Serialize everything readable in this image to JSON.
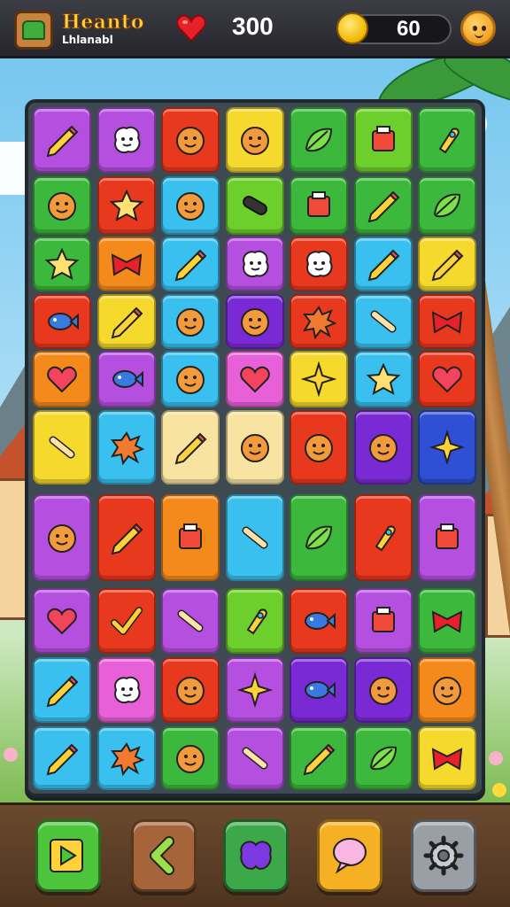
{
  "header": {
    "title": "Heanto",
    "subtitle": "Lhlanabl",
    "score": "300",
    "coins": "60"
  },
  "colors": {
    "purple": "#b54fe0",
    "red": "#e8381e",
    "yellow": "#f5d92c",
    "green": "#3cb83c",
    "blue": "#39c0ef",
    "orange": "#f58a1c",
    "dpurple": "#7a2ad4",
    "pink": "#e860d8",
    "cream": "#f8e4a0",
    "royal": "#2f4fd4",
    "lime": "#6ccf2c"
  },
  "board": {
    "rows": [
      [
        {
          "c": "purple",
          "i": "pencil"
        },
        {
          "c": "purple",
          "i": "blob-face"
        },
        {
          "c": "red",
          "i": "face"
        },
        {
          "c": "yellow",
          "i": "face"
        },
        {
          "c": "green",
          "i": "leaf"
        },
        {
          "c": "lime",
          "i": "box"
        },
        {
          "c": "green",
          "i": "rocket"
        }
      ],
      [
        {
          "c": "green",
          "i": "face"
        },
        {
          "c": "red",
          "i": "star"
        },
        {
          "c": "blue",
          "i": "face"
        },
        {
          "c": "lime",
          "i": "bar"
        },
        {
          "c": "green",
          "i": "box"
        },
        {
          "c": "green",
          "i": "pencil"
        },
        {
          "c": "green",
          "i": "leaf"
        }
      ],
      [
        {
          "c": "green",
          "i": "star"
        },
        {
          "c": "orange",
          "i": "bow"
        },
        {
          "c": "blue",
          "i": "pencil"
        },
        {
          "c": "purple",
          "i": "blob-face"
        },
        {
          "c": "red",
          "i": "blob-face"
        },
        {
          "c": "blue",
          "i": "pencil"
        },
        {
          "c": "yellow",
          "i": "pencil"
        }
      ],
      [
        {
          "c": "red",
          "i": "fish"
        },
        {
          "c": "yellow",
          "i": "pencil"
        },
        {
          "c": "blue",
          "i": "face"
        },
        {
          "c": "dpurple",
          "i": "face"
        },
        {
          "c": "red",
          "i": "splat"
        },
        {
          "c": "blue",
          "i": "bone"
        },
        {
          "c": "red",
          "i": "bow"
        }
      ],
      [
        {
          "c": "orange",
          "i": "heart"
        },
        {
          "c": "purple",
          "i": "fish"
        },
        {
          "c": "blue",
          "i": "face"
        },
        {
          "c": "pink",
          "i": "heart"
        },
        {
          "c": "yellow",
          "i": "sparkle"
        },
        {
          "c": "blue",
          "i": "star"
        },
        {
          "c": "red",
          "i": "heart"
        }
      ],
      [
        {
          "c": "yellow",
          "i": "bone"
        },
        {
          "c": "blue",
          "i": "splat"
        },
        {
          "c": "cream",
          "i": "pencil"
        },
        {
          "c": "cream",
          "i": "face"
        },
        {
          "c": "red",
          "i": "face"
        },
        {
          "c": "dpurple",
          "i": "face"
        },
        {
          "c": "royal",
          "i": "sparkle"
        }
      ],
      [
        {
          "c": "purple",
          "i": "face"
        },
        {
          "c": "red",
          "i": "pencil"
        },
        {
          "c": "orange",
          "i": "box"
        },
        {
          "c": "blue",
          "i": "bone"
        },
        {
          "c": "green",
          "i": "leaf"
        },
        {
          "c": "red",
          "i": "rocket"
        },
        {
          "c": "purple",
          "i": "box"
        }
      ],
      [
        {
          "c": "purple",
          "i": "heart"
        },
        {
          "c": "red",
          "i": "check"
        },
        {
          "c": "purple",
          "i": "bone"
        },
        {
          "c": "lime",
          "i": "rocket"
        },
        {
          "c": "red",
          "i": "fish"
        },
        {
          "c": "purple",
          "i": "box"
        },
        {
          "c": "green",
          "i": "bow"
        }
      ],
      [
        {
          "c": "blue",
          "i": "pencil"
        },
        {
          "c": "pink",
          "i": "blob-face"
        },
        {
          "c": "red",
          "i": "face"
        },
        {
          "c": "purple",
          "i": "sparkle"
        },
        {
          "c": "dpurple",
          "i": "fish"
        },
        {
          "c": "dpurple",
          "i": "face"
        },
        {
          "c": "orange",
          "i": "face"
        }
      ],
      [
        {
          "c": "blue",
          "i": "pencil"
        },
        {
          "c": "blue",
          "i": "splat"
        },
        {
          "c": "green",
          "i": "face"
        },
        {
          "c": "purple",
          "i": "bone"
        },
        {
          "c": "green",
          "i": "pencil"
        },
        {
          "c": "green",
          "i": "leaf"
        },
        {
          "c": "yellow",
          "i": "bow"
        }
      ]
    ]
  },
  "toolbar": [
    {
      "name": "play-button",
      "color": "#4cc43c",
      "icon": "play"
    },
    {
      "name": "back-button",
      "color": "#a5643a",
      "icon": "back"
    },
    {
      "name": "shuffle-button",
      "color": "#3ca84a",
      "icon": "blob"
    },
    {
      "name": "hint-button",
      "color": "#f5b024",
      "icon": "bubble"
    },
    {
      "name": "settings-button",
      "color": "#9a9fa6",
      "icon": "gear"
    }
  ]
}
